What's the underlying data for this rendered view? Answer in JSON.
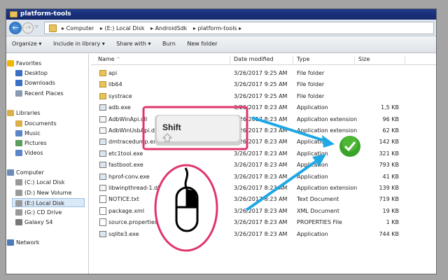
{
  "window": {
    "title": "platform-tools"
  },
  "address": {
    "crumbs": [
      "Computer",
      "(E:) Local Disk",
      "AndroidSdk",
      "platform-tools"
    ]
  },
  "toolbar": {
    "items": [
      "Organize ▾",
      "Include in library ▾",
      "Share with ▾",
      "Burn",
      "New folder"
    ]
  },
  "nav": [
    {
      "label": "Favorites",
      "head": true,
      "color": "#f4b400"
    },
    {
      "label": "Desktop",
      "color": "#3a6fc4"
    },
    {
      "label": "Downloads",
      "color": "#3a6fc4"
    },
    {
      "label": "Recent Places",
      "color": "#8a9bb0"
    },
    {
      "label": "Libraries",
      "head": true,
      "color": "#d9b04a"
    },
    {
      "label": "Documents",
      "color": "#d9b04a"
    },
    {
      "label": "Music",
      "color": "#5c84c8"
    },
    {
      "label": "Pictures",
      "color": "#5c9c5c"
    },
    {
      "label": "Videos",
      "color": "#5c84c8"
    },
    {
      "label": "Computer",
      "head": true,
      "color": "#6a8ab8"
    },
    {
      "label": "(C:) Local Disk",
      "color": "#999"
    },
    {
      "label": "(D:) New Volume",
      "color": "#999"
    },
    {
      "label": "(E:) Local Disk",
      "color": "#999",
      "selected": true
    },
    {
      "label": "(G:) CD Drive",
      "color": "#999"
    },
    {
      "label": "Galaxy S4",
      "color": "#777"
    },
    {
      "label": "Network",
      "head": true,
      "color": "#4a7ab8"
    }
  ],
  "columns": [
    "Name",
    "Date modified",
    "Type",
    "Size"
  ],
  "files": [
    {
      "name": "api",
      "date": "3/26/2017 9:25 AM",
      "type": "File folder",
      "size": "",
      "kind": "folder"
    },
    {
      "name": "lib64",
      "date": "3/26/2017 9:25 AM",
      "type": "File folder",
      "size": "",
      "kind": "folder"
    },
    {
      "name": "systrace",
      "date": "3/26/2017 9:25 AM",
      "type": "File folder",
      "size": "",
      "kind": "folder"
    },
    {
      "name": "adb.exe",
      "date": "3/26/2017 8:23 AM",
      "type": "Application",
      "size": "1,5   KB",
      "kind": "exe"
    },
    {
      "name": "AdbWinApi.dll",
      "date": "3/26/2017 8:23 AM",
      "type": "Application extension",
      "size": "96 KB",
      "kind": "dll"
    },
    {
      "name": "AdbWinUsbApi.dll",
      "date": "3/26/2017 8:23 AM",
      "type": "Application extension",
      "size": "62 KB",
      "kind": "dll"
    },
    {
      "name": "dmtracedump.exe",
      "date": "3/26/2017 8:23 AM",
      "type": "Application",
      "size": "142 KB",
      "kind": "exe"
    },
    {
      "name": "etc1tool.exe",
      "date": "3/26/2017 8:23 AM",
      "type": "Application",
      "size": "321 KB",
      "kind": "exe"
    },
    {
      "name": "fastboot.exe",
      "date": "3/26/2017 8:23 AM",
      "type": "Application",
      "size": "793 KB",
      "kind": "exe"
    },
    {
      "name": "hprof-conv.exe",
      "date": "3/26/2017 8:23 AM",
      "type": "Application",
      "size": "41 KB",
      "kind": "exe"
    },
    {
      "name": "libwinpthread-1.dll",
      "date": "3/26/2017 8:23 AM",
      "type": "Application extension",
      "size": "139 KB",
      "kind": "dll"
    },
    {
      "name": "NOTICE.txt",
      "date": "3/26/2017 8:23 AM",
      "type": "Text Document",
      "size": "719 KB",
      "kind": "txt"
    },
    {
      "name": "package.xml",
      "date": "3/26/2017 8:23 AM",
      "type": "XML Document",
      "size": "19 KB",
      "kind": "txt"
    },
    {
      "name": "source.properties",
      "date": "3/26/2017 8:23 AM",
      "type": "PROPERTIES File",
      "size": "1 KB",
      "kind": "txt"
    },
    {
      "name": "sqlite3.exe",
      "date": "3/26/2017 8:23 AM",
      "type": "Application",
      "size": "744 KB",
      "kind": "exe"
    }
  ],
  "overlay": {
    "key_label": "Shift",
    "accent": "#e0356a",
    "arrow": "#1ea8e6",
    "check": "#3aa32a"
  }
}
